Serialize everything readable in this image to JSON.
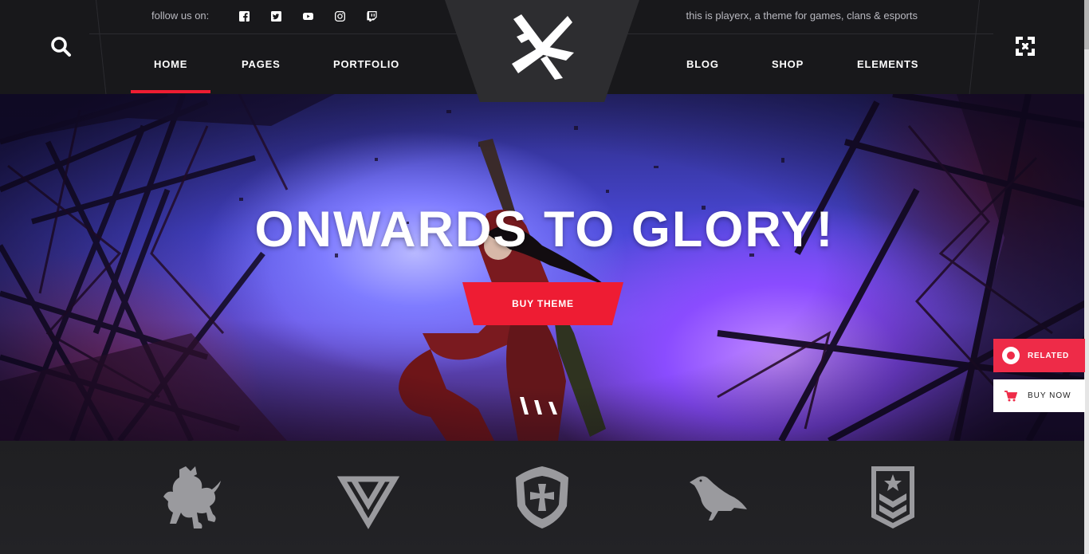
{
  "header": {
    "follow_label": "follow us on:",
    "socials": [
      "facebook-icon",
      "twitter-icon",
      "youtube-icon",
      "instagram-icon",
      "twitch-icon"
    ],
    "tagline": "this is playerx, a theme for games, clans & esports",
    "nav_left": [
      {
        "label": "HOME",
        "active": true
      },
      {
        "label": "PAGES"
      },
      {
        "label": "PORTFOLIO"
      }
    ],
    "nav_right": [
      {
        "label": "BLOG"
      },
      {
        "label": "SHOP"
      },
      {
        "label": "ELEMENTS"
      }
    ]
  },
  "hero": {
    "title": "ONWARDS TO GLORY!",
    "button": "BUY THEME"
  },
  "side": {
    "related": "RELATED",
    "buy_now": "BUY NOW"
  },
  "clans": [
    "lion-crest-icon",
    "triangle-knot-icon",
    "cross-shield-icon",
    "raven-icon",
    "chevron-badge-icon"
  ],
  "colors": {
    "accent": "#ee1c33",
    "related_bg": "#ee2b48",
    "header_bg": "#18181b",
    "clan_icon": "#9a9a9e"
  }
}
